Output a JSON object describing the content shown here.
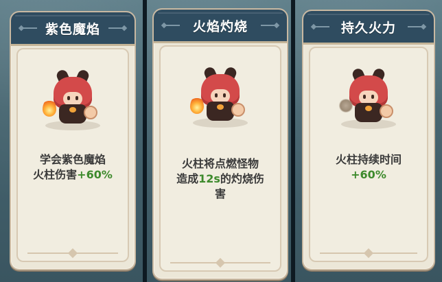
{
  "cards": [
    {
      "title": "紫色魔焰",
      "desc_line1": "学会紫色魔焰",
      "desc_line2_pre": "火柱伤害",
      "desc_line2_highlight": "+60%",
      "effect_icon": "fire-icon"
    },
    {
      "title": "火焰灼烧",
      "desc_line1": "火柱将点燃怪物",
      "desc_line2_pre": "造成",
      "desc_line2_highlight": "12s",
      "desc_line2_post": "的灼烧伤",
      "desc_line3": "害",
      "effect_icon": "fire-icon"
    },
    {
      "title": "持久火力",
      "desc_line1": "火柱持续时间",
      "desc_line2_highlight": "+60%",
      "effect_icon": "smoke-icon"
    }
  ],
  "colors": {
    "header_bg": "#2f4c60",
    "card_bg": "#ece7d8",
    "highlight_green": "#3d8a2c"
  }
}
